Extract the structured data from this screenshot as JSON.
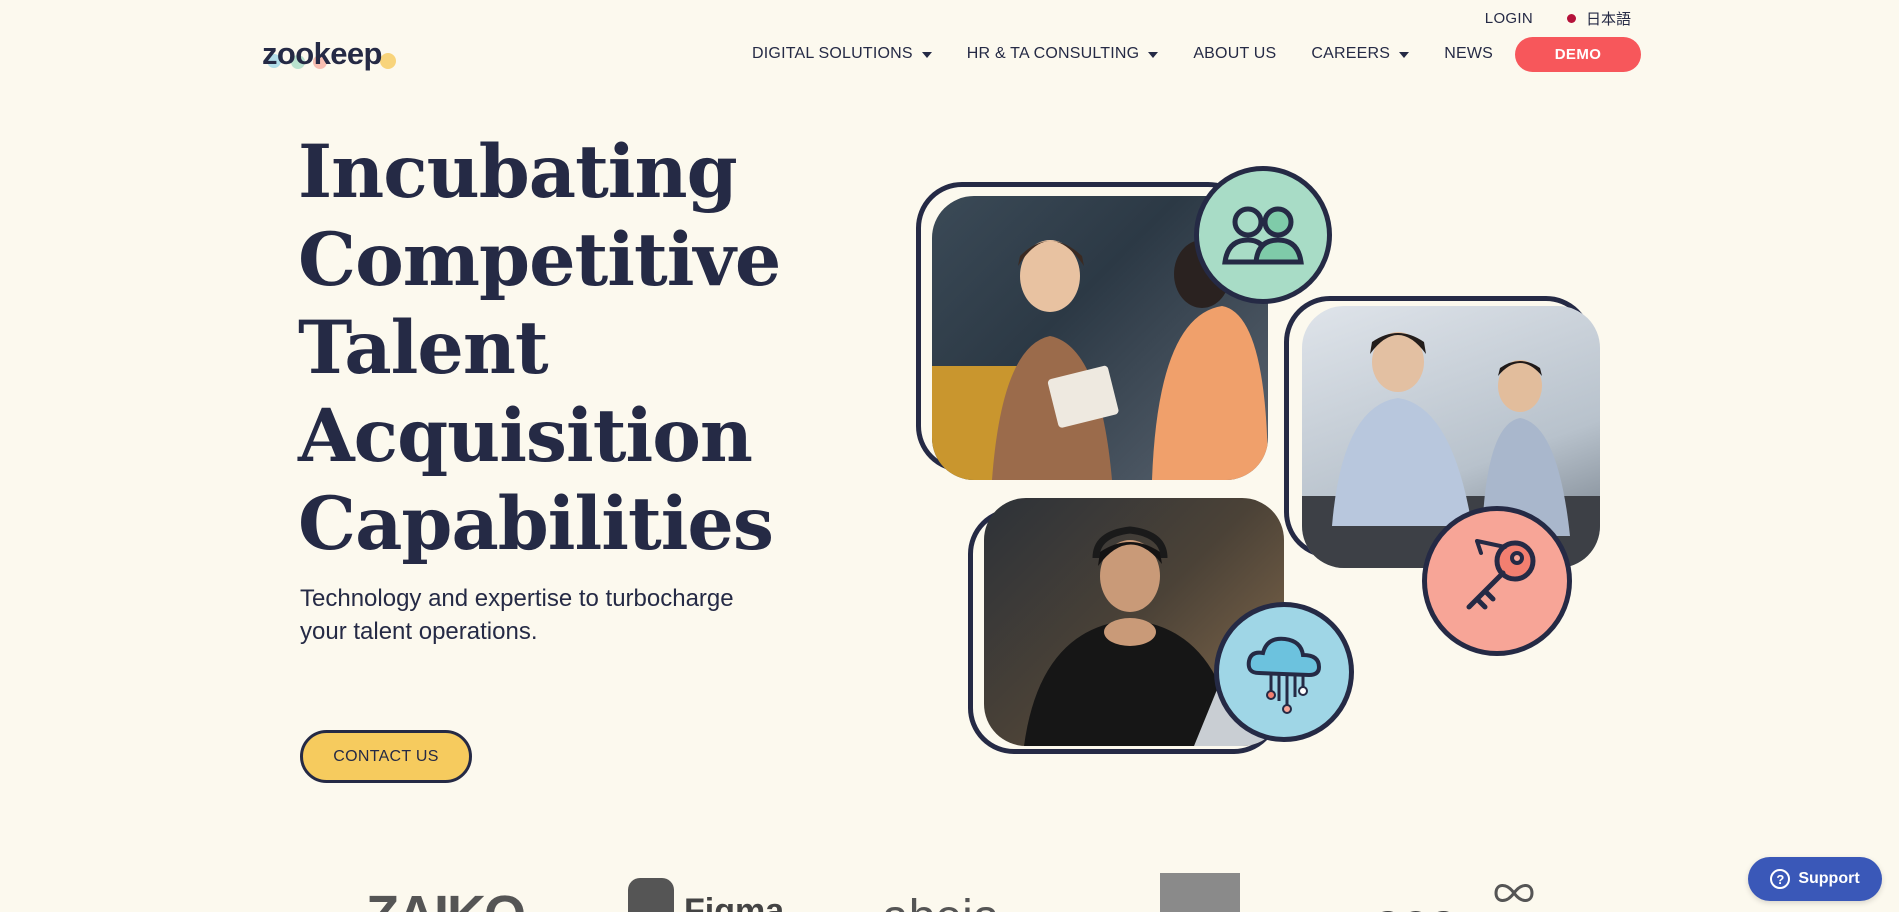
{
  "util_bar": {
    "login_label": "LOGIN",
    "language_label": "日本語"
  },
  "header": {
    "logo_text": "zookeep",
    "nav": [
      {
        "label": "DIGITAL SOLUTIONS",
        "has_dropdown": true
      },
      {
        "label": "HR & TA CONSULTING",
        "has_dropdown": true
      },
      {
        "label": "ABOUT US",
        "has_dropdown": false
      },
      {
        "label": "CAREERS",
        "has_dropdown": true
      },
      {
        "label": "NEWS",
        "has_dropdown": false
      }
    ],
    "demo_label": "DEMO"
  },
  "hero": {
    "title_lines": [
      "Incubating",
      "Competitive",
      "Talent",
      "Acquisition",
      "Capabilities"
    ],
    "subtitle_lines": [
      "Technology and expertise to turbocharge",
      "your talent operations."
    ],
    "cta_label": "CONTACT US"
  },
  "collage": {
    "badges": [
      "people-icon",
      "key-icon",
      "cloud-circuit-icon"
    ],
    "colors": {
      "mint": "#a8dcc6",
      "salmon": "#f7a597",
      "sky": "#9fd6e6",
      "navy": "#252a45"
    }
  },
  "clients": [
    "ZAIKO",
    "Figma",
    "abeja",
    "",
    "aea"
  ],
  "support": {
    "label": "Support"
  },
  "colors": {
    "background": "#fcf9ee",
    "text": "#252a45",
    "demo": "#f7575b",
    "cta": "#f6cb5e",
    "support": "#3a58b8"
  }
}
